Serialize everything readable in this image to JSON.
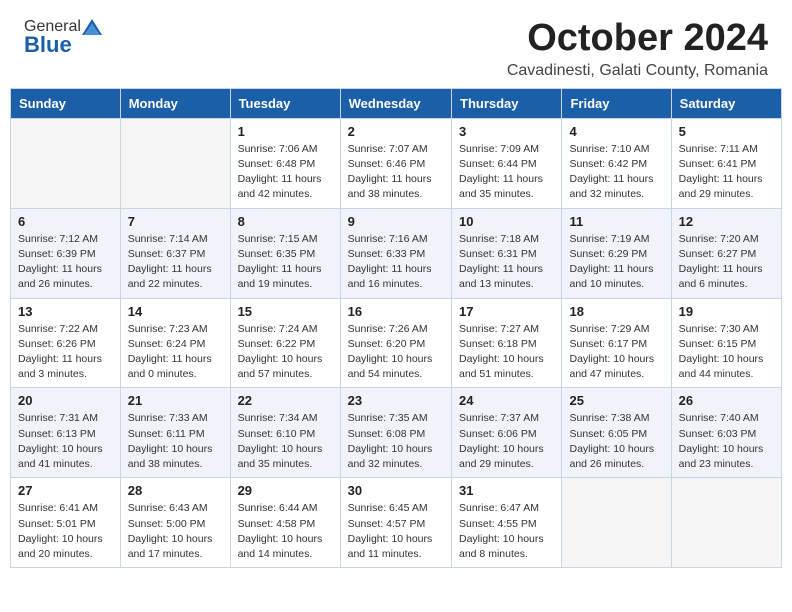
{
  "header": {
    "logo_general": "General",
    "logo_blue": "Blue",
    "month": "October 2024",
    "location": "Cavadinesti, Galati County, Romania"
  },
  "days_of_week": [
    "Sunday",
    "Monday",
    "Tuesday",
    "Wednesday",
    "Thursday",
    "Friday",
    "Saturday"
  ],
  "weeks": [
    [
      {
        "day": "",
        "empty": true
      },
      {
        "day": "",
        "empty": true
      },
      {
        "day": "1",
        "detail": "Sunrise: 7:06 AM\nSunset: 6:48 PM\nDaylight: 11 hours and 42 minutes."
      },
      {
        "day": "2",
        "detail": "Sunrise: 7:07 AM\nSunset: 6:46 PM\nDaylight: 11 hours and 38 minutes."
      },
      {
        "day": "3",
        "detail": "Sunrise: 7:09 AM\nSunset: 6:44 PM\nDaylight: 11 hours and 35 minutes."
      },
      {
        "day": "4",
        "detail": "Sunrise: 7:10 AM\nSunset: 6:42 PM\nDaylight: 11 hours and 32 minutes."
      },
      {
        "day": "5",
        "detail": "Sunrise: 7:11 AM\nSunset: 6:41 PM\nDaylight: 11 hours and 29 minutes."
      }
    ],
    [
      {
        "day": "6",
        "detail": "Sunrise: 7:12 AM\nSunset: 6:39 PM\nDaylight: 11 hours and 26 minutes."
      },
      {
        "day": "7",
        "detail": "Sunrise: 7:14 AM\nSunset: 6:37 PM\nDaylight: 11 hours and 22 minutes."
      },
      {
        "day": "8",
        "detail": "Sunrise: 7:15 AM\nSunset: 6:35 PM\nDaylight: 11 hours and 19 minutes."
      },
      {
        "day": "9",
        "detail": "Sunrise: 7:16 AM\nSunset: 6:33 PM\nDaylight: 11 hours and 16 minutes."
      },
      {
        "day": "10",
        "detail": "Sunrise: 7:18 AM\nSunset: 6:31 PM\nDaylight: 11 hours and 13 minutes."
      },
      {
        "day": "11",
        "detail": "Sunrise: 7:19 AM\nSunset: 6:29 PM\nDaylight: 11 hours and 10 minutes."
      },
      {
        "day": "12",
        "detail": "Sunrise: 7:20 AM\nSunset: 6:27 PM\nDaylight: 11 hours and 6 minutes."
      }
    ],
    [
      {
        "day": "13",
        "detail": "Sunrise: 7:22 AM\nSunset: 6:26 PM\nDaylight: 11 hours and 3 minutes."
      },
      {
        "day": "14",
        "detail": "Sunrise: 7:23 AM\nSunset: 6:24 PM\nDaylight: 11 hours and 0 minutes."
      },
      {
        "day": "15",
        "detail": "Sunrise: 7:24 AM\nSunset: 6:22 PM\nDaylight: 10 hours and 57 minutes."
      },
      {
        "day": "16",
        "detail": "Sunrise: 7:26 AM\nSunset: 6:20 PM\nDaylight: 10 hours and 54 minutes."
      },
      {
        "day": "17",
        "detail": "Sunrise: 7:27 AM\nSunset: 6:18 PM\nDaylight: 10 hours and 51 minutes."
      },
      {
        "day": "18",
        "detail": "Sunrise: 7:29 AM\nSunset: 6:17 PM\nDaylight: 10 hours and 47 minutes."
      },
      {
        "day": "19",
        "detail": "Sunrise: 7:30 AM\nSunset: 6:15 PM\nDaylight: 10 hours and 44 minutes."
      }
    ],
    [
      {
        "day": "20",
        "detail": "Sunrise: 7:31 AM\nSunset: 6:13 PM\nDaylight: 10 hours and 41 minutes."
      },
      {
        "day": "21",
        "detail": "Sunrise: 7:33 AM\nSunset: 6:11 PM\nDaylight: 10 hours and 38 minutes."
      },
      {
        "day": "22",
        "detail": "Sunrise: 7:34 AM\nSunset: 6:10 PM\nDaylight: 10 hours and 35 minutes."
      },
      {
        "day": "23",
        "detail": "Sunrise: 7:35 AM\nSunset: 6:08 PM\nDaylight: 10 hours and 32 minutes."
      },
      {
        "day": "24",
        "detail": "Sunrise: 7:37 AM\nSunset: 6:06 PM\nDaylight: 10 hours and 29 minutes."
      },
      {
        "day": "25",
        "detail": "Sunrise: 7:38 AM\nSunset: 6:05 PM\nDaylight: 10 hours and 26 minutes."
      },
      {
        "day": "26",
        "detail": "Sunrise: 7:40 AM\nSunset: 6:03 PM\nDaylight: 10 hours and 23 minutes."
      }
    ],
    [
      {
        "day": "27",
        "detail": "Sunrise: 6:41 AM\nSunset: 5:01 PM\nDaylight: 10 hours and 20 minutes."
      },
      {
        "day": "28",
        "detail": "Sunrise: 6:43 AM\nSunset: 5:00 PM\nDaylight: 10 hours and 17 minutes."
      },
      {
        "day": "29",
        "detail": "Sunrise: 6:44 AM\nSunset: 4:58 PM\nDaylight: 10 hours and 14 minutes."
      },
      {
        "day": "30",
        "detail": "Sunrise: 6:45 AM\nSunset: 4:57 PM\nDaylight: 10 hours and 11 minutes."
      },
      {
        "day": "31",
        "detail": "Sunrise: 6:47 AM\nSunset: 4:55 PM\nDaylight: 10 hours and 8 minutes."
      },
      {
        "day": "",
        "empty": true
      },
      {
        "day": "",
        "empty": true
      }
    ]
  ]
}
